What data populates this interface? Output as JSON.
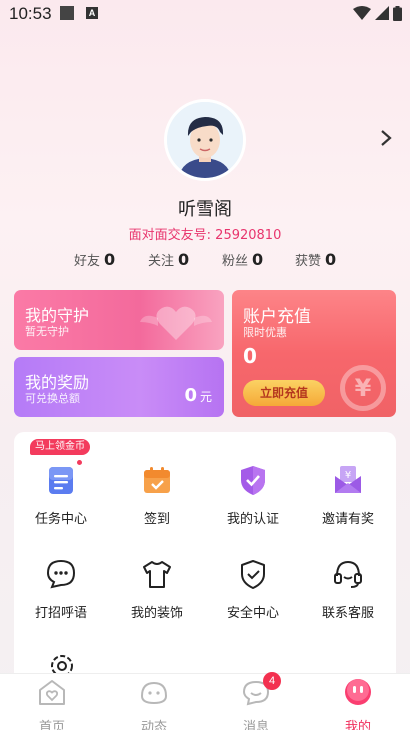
{
  "status": {
    "time": "10:53",
    "notif_letter": "A"
  },
  "profile": {
    "nickname": "听雪阁",
    "friend_id": "面对面交友号: 25920810",
    "stats": [
      {
        "label": "好友",
        "value": "0"
      },
      {
        "label": "关注",
        "value": "0"
      },
      {
        "label": "粉丝",
        "value": "0"
      },
      {
        "label": "获赞",
        "value": "0"
      }
    ]
  },
  "cards": {
    "guard": {
      "title": "我的守护",
      "subtitle": "暂无守护"
    },
    "reward": {
      "title": "我的奖励",
      "subtitle": "可兑换总额",
      "amount": "0",
      "unit": "元"
    },
    "recharge": {
      "title": "账户充值",
      "subtitle": "限时优惠",
      "value": "0",
      "button": "立即充值",
      "coin_symbol": "¥"
    }
  },
  "features": {
    "tip": "马上领金币",
    "items": [
      {
        "label": "任务中心",
        "icon": "task-icon"
      },
      {
        "label": "签到",
        "icon": "calendar-icon"
      },
      {
        "label": "我的认证",
        "icon": "shield-check-icon"
      },
      {
        "label": "邀请有奖",
        "icon": "envelope-yen-icon"
      },
      {
        "label": "打招呼语",
        "icon": "chat-dots-icon"
      },
      {
        "label": "我的装饰",
        "icon": "shirt-icon"
      },
      {
        "label": "安全中心",
        "icon": "shield-icon"
      },
      {
        "label": "联系客服",
        "icon": "headset-icon"
      }
    ]
  },
  "nav": {
    "items": [
      {
        "label": "首页",
        "icon": "home-heart-icon",
        "active": false
      },
      {
        "label": "动态",
        "icon": "moments-icon",
        "active": false
      },
      {
        "label": "消息",
        "icon": "message-icon",
        "active": false,
        "badge": "4"
      },
      {
        "label": "我的",
        "icon": "profile-blob-icon",
        "active": true
      }
    ]
  },
  "colors": {
    "accent": "#f0305d",
    "friend_id": "#e8356d",
    "recharge_btn": "#f5a938"
  }
}
